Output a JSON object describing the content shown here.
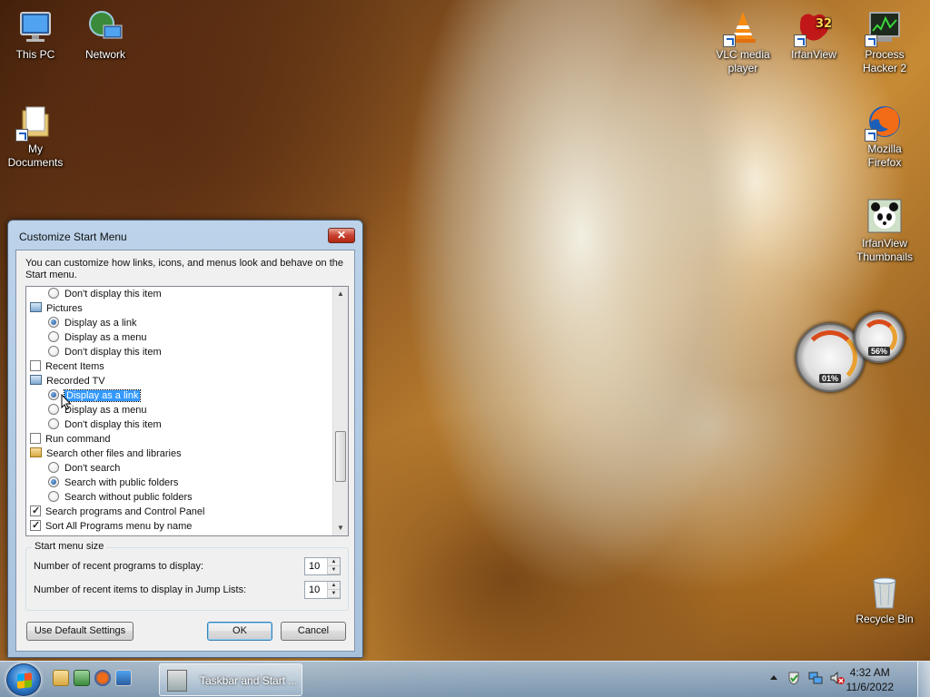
{
  "desktop": {
    "icons_left": [
      {
        "label": "This PC",
        "icon": "computer-icon"
      },
      {
        "label": "Network",
        "icon": "network-icon"
      },
      {
        "label": "My Documents",
        "icon": "documents-folder-icon"
      }
    ],
    "icons_right": [
      {
        "label": "VLC media player",
        "icon": "vlc-icon"
      },
      {
        "label": "IrfanView",
        "icon": "irfanview-icon"
      },
      {
        "label": "Process Hacker 2",
        "icon": "process-hacker-icon"
      },
      {
        "label": "Mozilla Firefox",
        "icon": "firefox-icon"
      },
      {
        "label": "IrfanView Thumbnails",
        "icon": "irfanview-thumbnails-icon"
      },
      {
        "label": "Recycle Bin",
        "icon": "recycle-bin-icon"
      }
    ],
    "gadget": {
      "cpu_value": "01%",
      "memory_value": "56%"
    }
  },
  "dialog": {
    "title": "Customize Start Menu",
    "close_label": "✕",
    "intro": "You can customize how links, icons, and menus look and behave on the Start menu.",
    "list": [
      {
        "type": "radio",
        "label": "Don't display this item",
        "checked": false
      },
      {
        "type": "category",
        "label": "Pictures",
        "icon": "pictures-icon"
      },
      {
        "type": "radio",
        "label": "Display as a link",
        "checked": true
      },
      {
        "type": "radio",
        "label": "Display as a menu",
        "checked": false
      },
      {
        "type": "radio",
        "label": "Don't display this item",
        "checked": false
      },
      {
        "type": "checkbox",
        "label": "Recent Items",
        "checked": false
      },
      {
        "type": "category",
        "label": "Recorded TV",
        "icon": "recorded-tv-icon"
      },
      {
        "type": "radio",
        "label": "Display as a link",
        "checked": true,
        "selected": true
      },
      {
        "type": "radio",
        "label": "Display as a menu",
        "checked": false
      },
      {
        "type": "radio",
        "label": "Don't display this item",
        "checked": false
      },
      {
        "type": "checkbox",
        "label": "Run command",
        "checked": false
      },
      {
        "type": "category",
        "label": "Search other files and libraries",
        "icon": "search-folder-icon"
      },
      {
        "type": "radio",
        "label": "Don't search",
        "checked": false
      },
      {
        "type": "radio",
        "label": "Search with public folders",
        "checked": true
      },
      {
        "type": "radio",
        "label": "Search without public folders",
        "checked": false
      },
      {
        "type": "checkbox",
        "label": "Search programs and Control Panel",
        "checked": true
      },
      {
        "type": "checkbox",
        "label": "Sort All Programs menu by name",
        "checked": true
      }
    ],
    "size_group": {
      "legend": "Start menu size",
      "recent_programs_label": "Number of recent programs to display:",
      "recent_programs_value": "10",
      "jump_list_label": "Number of recent items to display in Jump Lists:",
      "jump_list_value": "10"
    },
    "buttons": {
      "defaults": "Use Default Settings",
      "ok": "OK",
      "cancel": "Cancel"
    }
  },
  "taskbar": {
    "active_task_label": "Taskbar and Start ...",
    "clock_time": "4:32 AM",
    "clock_date": "11/6/2022"
  }
}
